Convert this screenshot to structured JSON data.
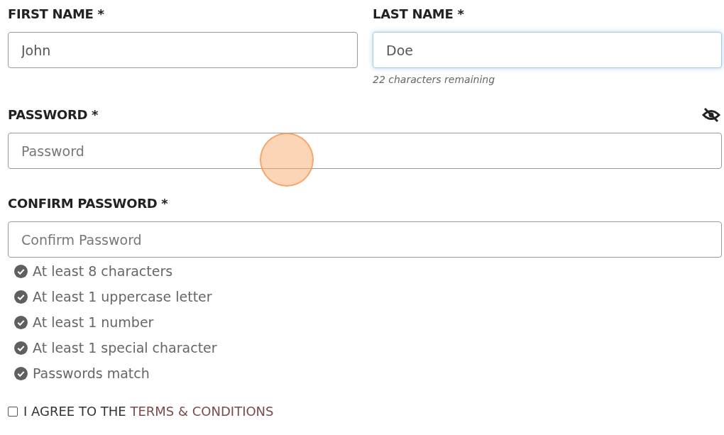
{
  "name_fields": [
    {
      "label": "FIRST NAME *",
      "value": "John",
      "focused": false
    },
    {
      "label": "LAST NAME *",
      "value": "Doe",
      "focused": true,
      "hint": "22 characters remaining"
    }
  ],
  "password": {
    "label": "PASSWORD *",
    "placeholder": "Password",
    "visible": false
  },
  "confirm_password": {
    "label": "CONFIRM PASSWORD *",
    "placeholder": "Confirm Password"
  },
  "rules": [
    {
      "text": "At least 8 characters",
      "met": true
    },
    {
      "text": "At least 1 uppercase letter",
      "met": true
    },
    {
      "text": "At least 1 number",
      "met": true
    },
    {
      "text": "At least 1 special character",
      "met": true
    },
    {
      "text": "Passwords match",
      "met": true
    }
  ],
  "agree": {
    "text": "I AGREE TO THE ",
    "link": "TERMS & CONDITIONS",
    "checked": false
  }
}
